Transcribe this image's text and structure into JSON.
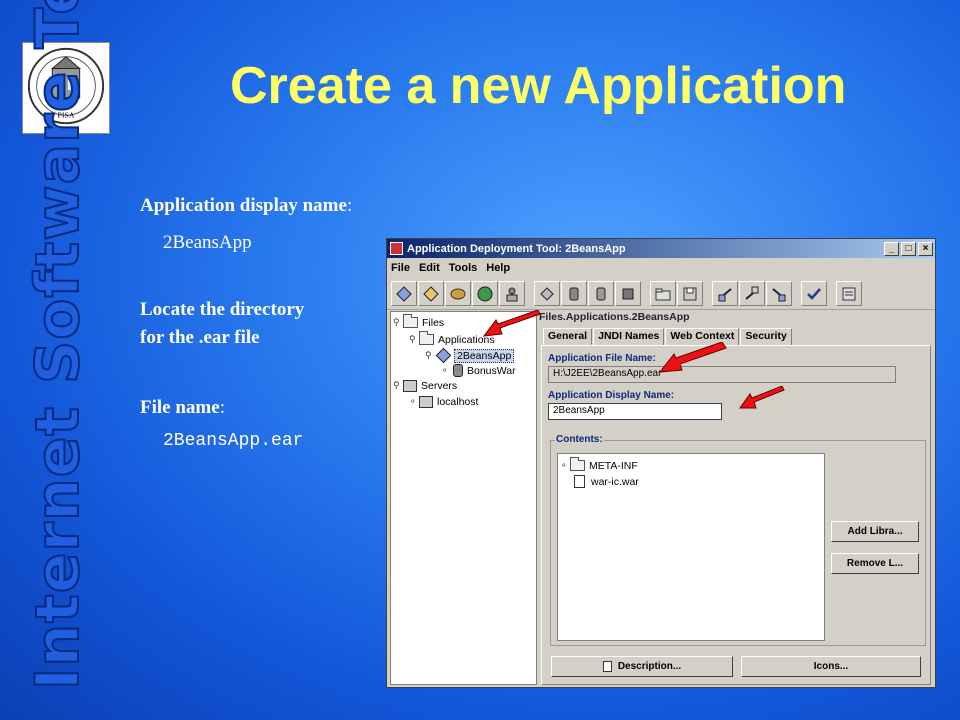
{
  "slide": {
    "title": "Create a new Application",
    "vertical_title": "Internet Software Technologies",
    "logo_text": "PISA",
    "bullets": [
      {
        "label": "Application display name",
        "sep": ":",
        "value": "2BeansApp"
      },
      {
        "line1": "Locate the directory",
        "line2": "for the .ear file"
      },
      {
        "label": "File name",
        "sep": ":",
        "value": "2BeansApp.ear"
      }
    ]
  },
  "window": {
    "title": "Application Deployment Tool: 2BeansApp",
    "controls": [
      "_",
      "□",
      "×"
    ],
    "menus": [
      "File",
      "Edit",
      "Tools",
      "Help"
    ],
    "tree": {
      "root": "Files",
      "applications": "Applications",
      "app": "2BeansApp",
      "war": "BonusWar",
      "servers": "Servers",
      "host": "localhost"
    },
    "path": "Files.Applications.2BeansApp",
    "tabs": [
      "General",
      "JNDI Names",
      "Web Context",
      "Security"
    ],
    "active_tab": "General",
    "app_file_label": "Application File Name:",
    "app_file_value": "H:\\J2EE\\2BeansApp.ear",
    "display_label": "Application Display Name:",
    "display_value": "2BeansApp",
    "contents_label": "Contents:",
    "contents": [
      "META-INF",
      "war-ic.war"
    ],
    "add_button": "Add Libra...",
    "remove_button": "Remove L...",
    "description_button": "Description...",
    "icons_button": "Icons..."
  },
  "colors": {
    "title": "#ffff66",
    "arrow": "#ee1111",
    "vertical_title": "#1f5fe0"
  }
}
